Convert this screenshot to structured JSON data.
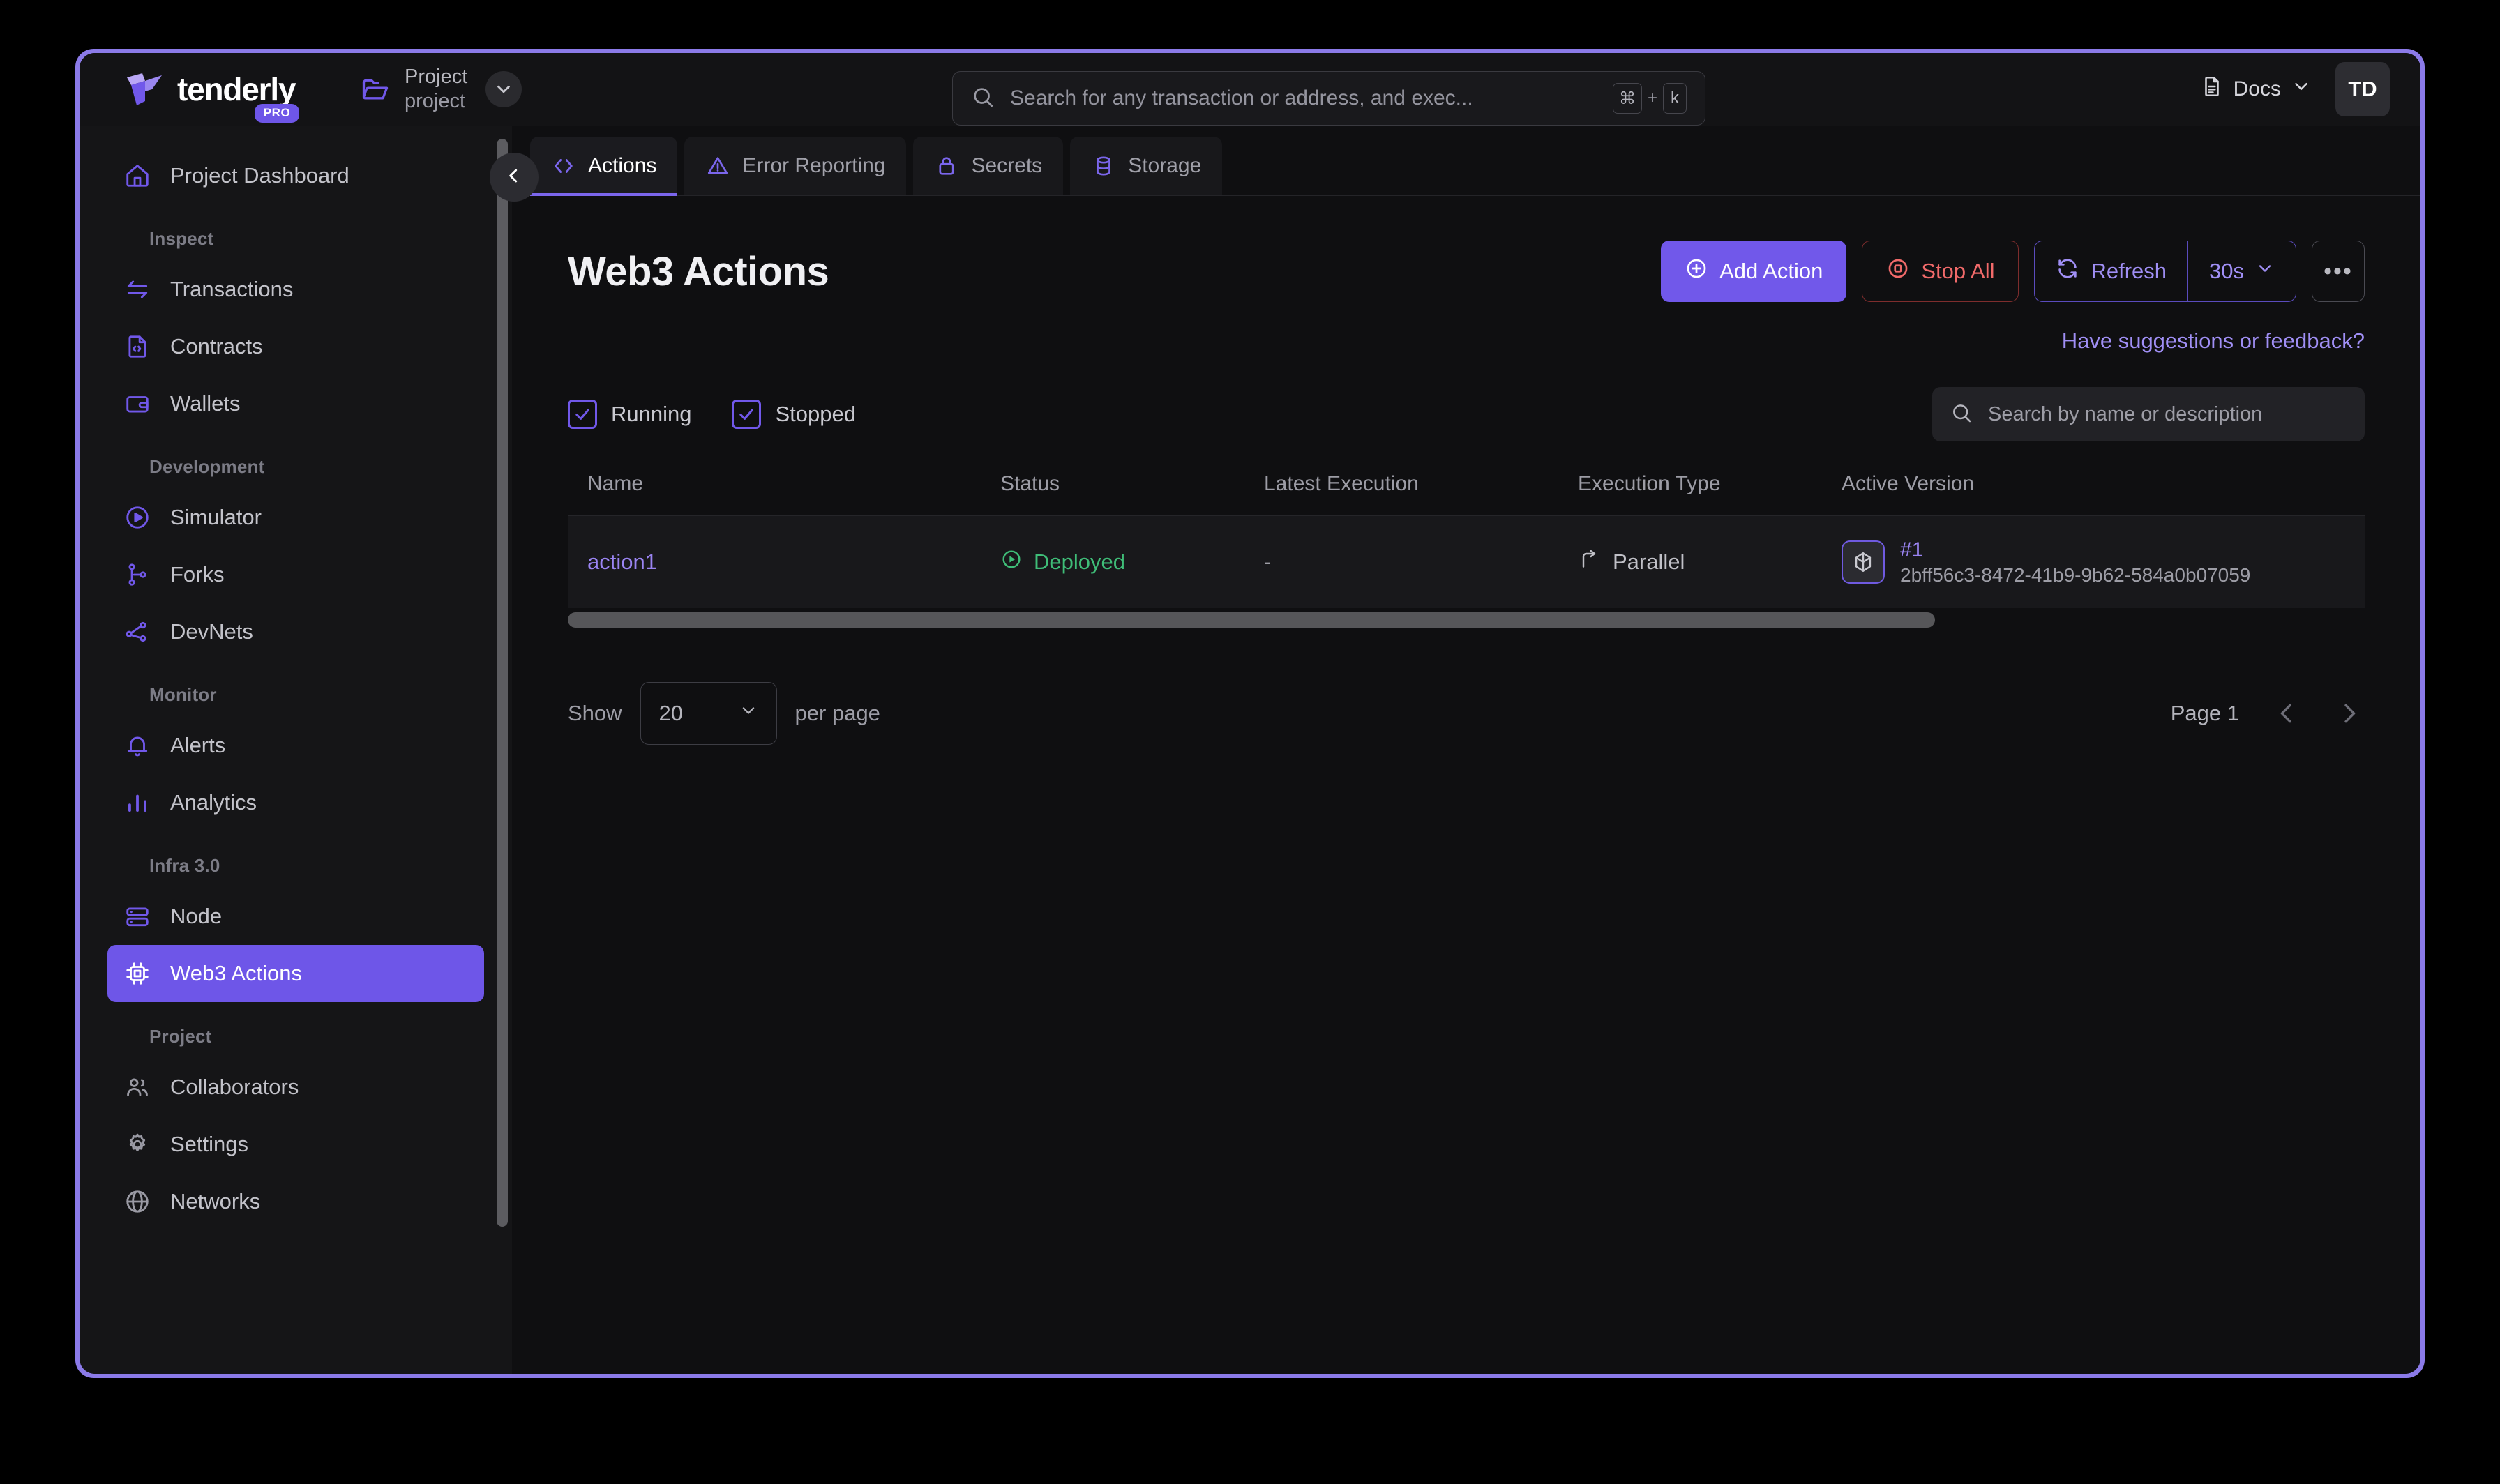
{
  "brand": {
    "name": "tenderly",
    "badge": "PRO",
    "accent": "#7158ea"
  },
  "project_selector": {
    "title": "Project",
    "subtitle": "project",
    "folder_icon": "folder-icon",
    "chevron_icon": "chevron-down-icon"
  },
  "global_search": {
    "placeholder": "Search for any transaction or address, and exec...",
    "icon": "search-icon",
    "shortcut_modifier": "⌘",
    "shortcut_plus": "+",
    "shortcut_key": "k"
  },
  "topbar": {
    "docs_label": "Docs",
    "docs_icon": "document-icon",
    "docs_chevron_icon": "chevron-down-icon",
    "avatar_initials": "TD"
  },
  "sidebar": {
    "collapse_icon": "chevron-left-icon",
    "dashboard": {
      "label": "Project Dashboard",
      "icon": "home-icon"
    },
    "sections": [
      {
        "label": "Inspect",
        "items": [
          {
            "label": "Transactions",
            "icon": "transactions-icon"
          },
          {
            "label": "Contracts",
            "icon": "contract-file-icon"
          },
          {
            "label": "Wallets",
            "icon": "wallet-icon"
          }
        ]
      },
      {
        "label": "Development",
        "items": [
          {
            "label": "Simulator",
            "icon": "play-circle-icon"
          },
          {
            "label": "Forks",
            "icon": "git-branch-icon"
          },
          {
            "label": "DevNets",
            "icon": "nodes-icon"
          }
        ]
      },
      {
        "label": "Monitor",
        "items": [
          {
            "label": "Alerts",
            "icon": "bell-icon"
          },
          {
            "label": "Analytics",
            "icon": "bar-chart-icon"
          }
        ]
      },
      {
        "label": "Infra 3.0",
        "items": [
          {
            "label": "Node",
            "icon": "server-icon"
          },
          {
            "label": "Web3 Actions",
            "icon": "chip-icon",
            "active": true
          }
        ]
      },
      {
        "label": "Project",
        "items": [
          {
            "label": "Collaborators",
            "icon": "users-icon"
          },
          {
            "label": "Settings",
            "icon": "gear-icon"
          },
          {
            "label": "Networks",
            "icon": "globe-icon"
          }
        ]
      }
    ]
  },
  "tabs": [
    {
      "label": "Actions",
      "icon": "code-brackets-icon",
      "active": true
    },
    {
      "label": "Error Reporting",
      "icon": "warning-triangle-icon",
      "active": false
    },
    {
      "label": "Secrets",
      "icon": "lock-icon",
      "active": false
    },
    {
      "label": "Storage",
      "icon": "database-icon",
      "active": false
    }
  ],
  "page": {
    "title": "Web3 Actions",
    "feedback_link": "Have suggestions or feedback?"
  },
  "toolbar": {
    "add_action_label": "Add Action",
    "add_action_icon": "plus-circle-icon",
    "stop_all_label": "Stop All",
    "stop_all_icon": "stop-circle-icon",
    "refresh_label": "Refresh",
    "refresh_icon": "refresh-icon",
    "refresh_interval": "30s",
    "refresh_chevron_icon": "chevron-down-icon",
    "more_label": "•••"
  },
  "filters": {
    "running_label": "Running",
    "running_checked": true,
    "stopped_label": "Stopped",
    "stopped_checked": true,
    "search_placeholder": "Search by name or description",
    "search_icon": "search-icon"
  },
  "table": {
    "columns": [
      "Name",
      "Status",
      "Latest Execution",
      "Execution Type",
      "Active Version"
    ],
    "rows": [
      {
        "name": "action1",
        "status": "Deployed",
        "status_icon": "play-circle-icon",
        "latest_execution": "-",
        "execution_type": "Parallel",
        "execution_type_icon": "branch-icon",
        "version_icon": "cube-icon",
        "version_number": "#1",
        "version_uuid": "2bff56c3-8472-41b9-9b62-584a0b07059"
      }
    ]
  },
  "pagination": {
    "show_label": "Show",
    "per_page_value": "20",
    "per_page_chevron_icon": "chevron-down-icon",
    "per_page_label": "per page",
    "page_label": "Page 1",
    "prev_icon": "chevron-left-icon",
    "next_icon": "chevron-right-icon"
  }
}
